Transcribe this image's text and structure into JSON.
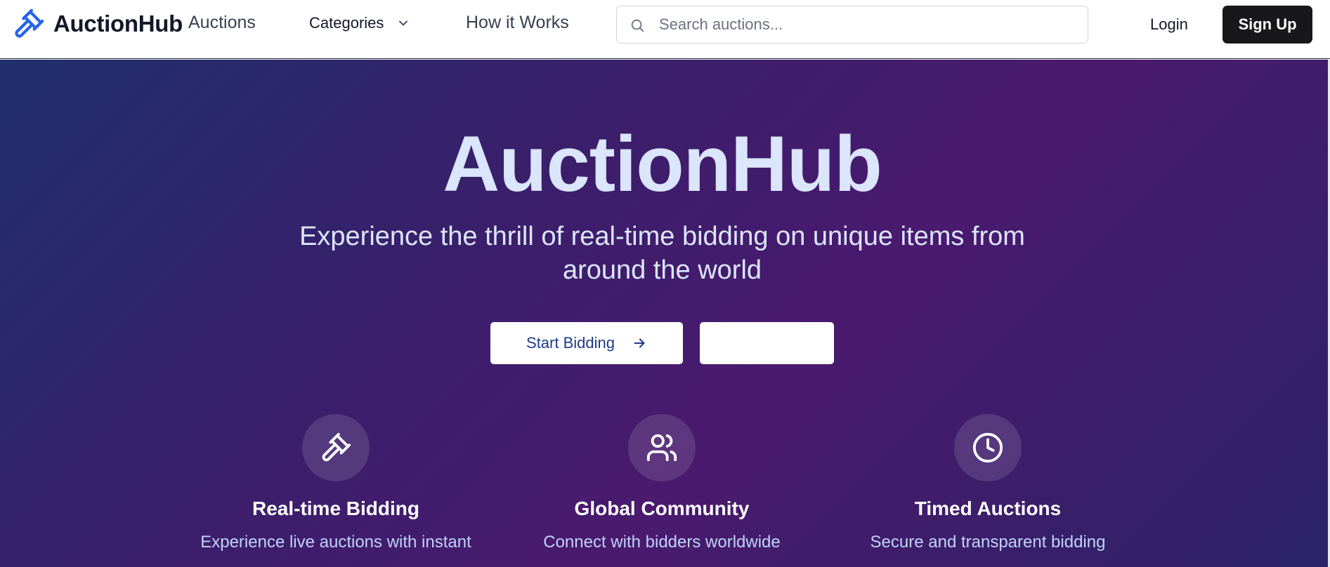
{
  "brand": {
    "name": "AuctionHub",
    "accent": "#2563eb"
  },
  "nav": {
    "auctions": "Auctions",
    "categories": "Categories",
    "how_it_works": "How it Works",
    "search_placeholder": "Search auctions...",
    "login": "Login",
    "signup": "Sign Up"
  },
  "hero": {
    "title": "AuctionHub",
    "subtitle": "Experience the thrill of real-time bidding on unique items from around the world",
    "primary_button": "Start Bidding",
    "secondary_button": ""
  },
  "features": [
    {
      "icon": "gavel-icon",
      "title": "Real-time Bidding",
      "description": "Experience live auctions with instant"
    },
    {
      "icon": "users-icon",
      "title": "Global Community",
      "description": "Connect with bidders worldwide"
    },
    {
      "icon": "clock-icon",
      "title": "Timed Auctions",
      "description": "Secure and transparent bidding"
    }
  ],
  "colors": {
    "hero_gradient_start": "#1f2f6d",
    "hero_gradient_mid": "#4a1a6e",
    "hero_text": "#dbe6fc",
    "signup_bg": "#18181b"
  }
}
